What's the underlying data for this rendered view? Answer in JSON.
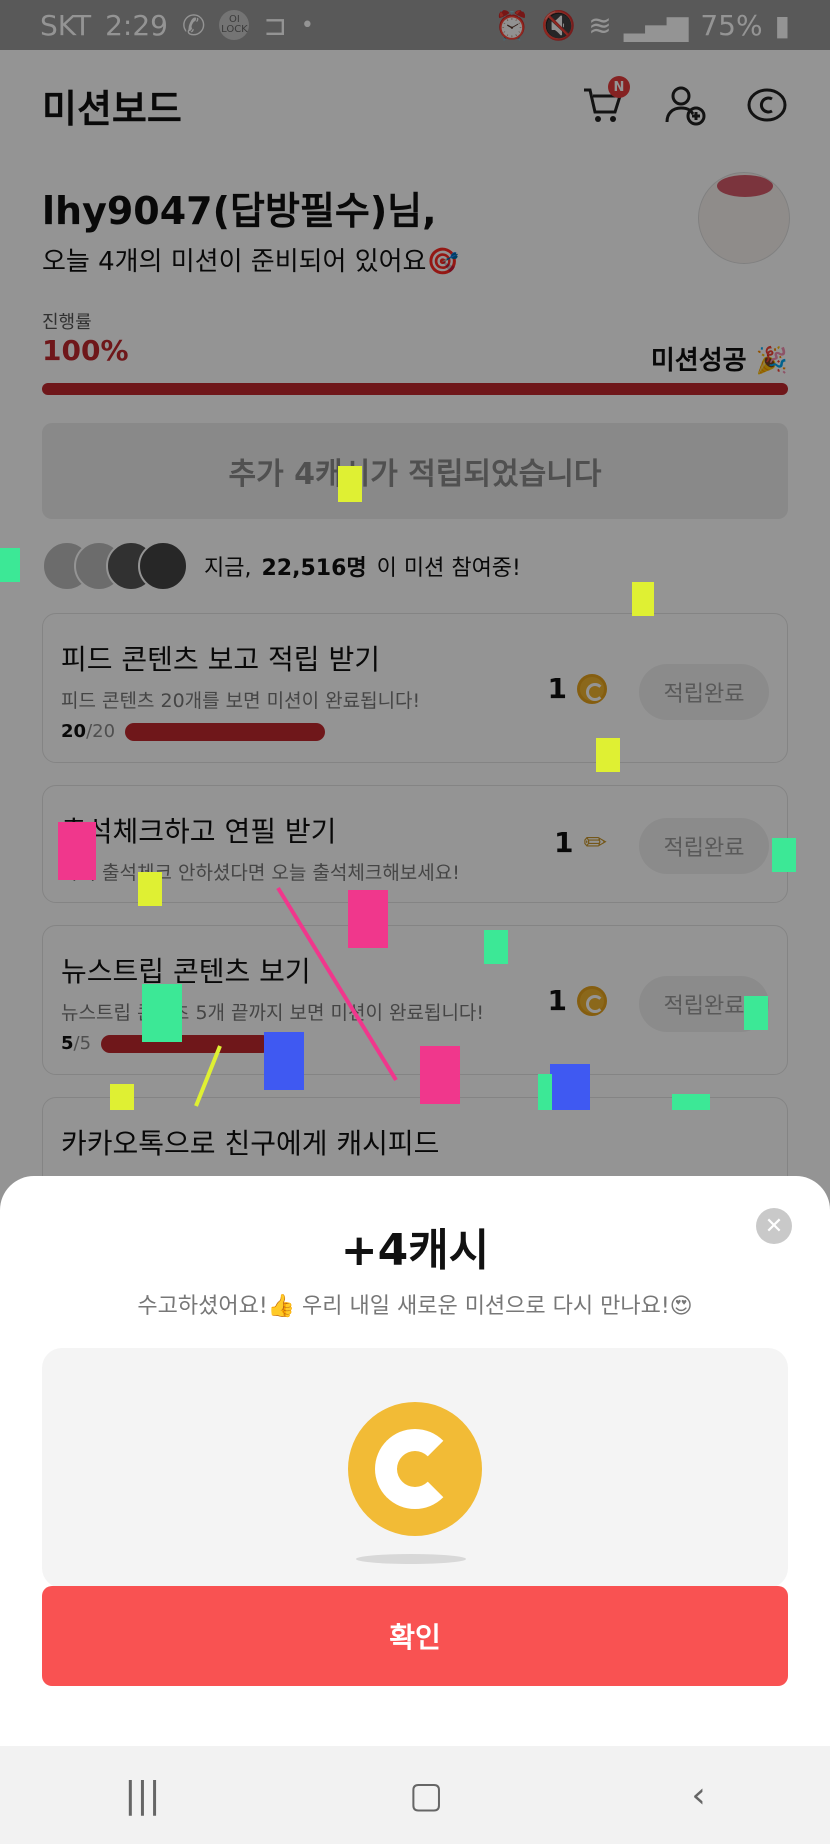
{
  "status_bar": {
    "carrier": "SKT",
    "time": "2:29",
    "lock_label": "OI LOCK",
    "battery": "75%"
  },
  "header": {
    "title": "미션보드",
    "cart_badge": "N"
  },
  "greeting": {
    "name": "lhy9047(답방필수)님,",
    "subtitle": "오늘 4개의 미션이 준비되어 있어요🎯"
  },
  "progress": {
    "label": "진행률",
    "percent_text": "100%",
    "value": 100,
    "status": "미션성공 🎉"
  },
  "banner": {
    "text": "추가 4캐시가 적립되었습니다"
  },
  "participants": {
    "prefix": "지금,",
    "count": "22,516명",
    "suffix": "이 미션 참여중!"
  },
  "missions": [
    {
      "title": "피드 콘텐츠 보고 적립 받기",
      "description": "피드 콘텐츠 20개를 보면 미션이 완료됩니다!",
      "progress_current": "20",
      "progress_total": "/20",
      "reward": "1",
      "reward_icon": "coin-icon",
      "button": "적립완료"
    },
    {
      "title": "출석체크하고 연필 받기",
      "description": "아직 출석체크 안하셨다면 오늘 출석체크해보세요!",
      "reward": "1",
      "reward_icon": "pencil-icon",
      "button": "적립완료"
    },
    {
      "title": "뉴스트립 콘텐츠 보기",
      "description": "뉴스트립 콘텐츠 5개 끝까지 보면 미션이 완료됩니다!",
      "progress_current": "5",
      "progress_total": "/5",
      "reward": "1",
      "reward_icon": "coin-icon",
      "button": "적립완료"
    },
    {
      "title": "카카오톡으로 친구에게 캐시피드"
    }
  ],
  "sheet": {
    "amount": "+4캐시",
    "message": "수고하셨어요!👍 우리 내일 새로운 미션으로 다시 만나요!😍",
    "confirm": "확인",
    "close": "✕"
  },
  "colors": {
    "accent": "#c0282d",
    "confirm": "#f95252",
    "coin": "#f2bb36"
  }
}
